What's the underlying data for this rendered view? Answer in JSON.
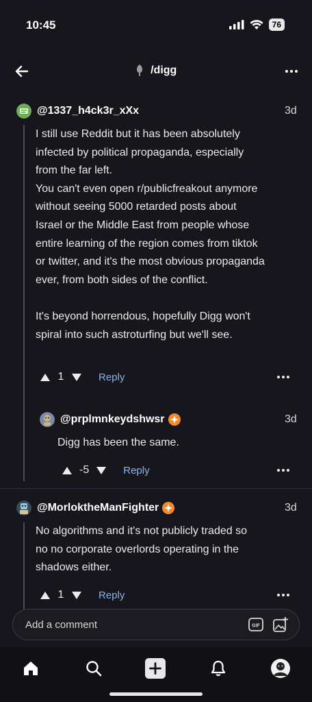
{
  "status_bar": {
    "time": "10:45",
    "battery": "76"
  },
  "header": {
    "community": "/digg"
  },
  "comments": [
    {
      "username": "@1337_h4ck3r_xXx",
      "age": "3d",
      "body": "I still use Reddit but it has been absolutely\ninfected by political propaganda, especially\nfrom the far left.\nYou can't even open r/publicfreakout anymore\nwithout seeing 5000 retarded posts about\nIsrael or the Middle East from people whose\nentire learning of the region comes from tiktok\nor twitter, and it's the most obvious propaganda\never, from both sides of the conflict.\n\nIt's beyond horrendous, hopefully Digg won't\nspiral into such astroturfing but we'll see.",
      "score": "1",
      "reply_label": "Reply",
      "has_badge": false
    },
    {
      "username": "@prplmnkeydshwsr",
      "age": "3d",
      "body": "Digg has been the same.",
      "score": "-5",
      "reply_label": "Reply",
      "has_badge": true
    },
    {
      "username": "@MorloktheManFighter",
      "age": "3d",
      "body": "No algorithms and it's not publicly traded so\nno no corporate overlords operating in the\nshadows either.",
      "score": "1",
      "reply_label": "Reply",
      "has_badge": true
    }
  ],
  "composer": {
    "placeholder": "Add a comment"
  },
  "tabbar": {
    "items": [
      "home-icon",
      "search-icon",
      "create-icon",
      "notifications-icon",
      "profile-icon"
    ]
  },
  "colors": {
    "background": "#17161c",
    "link": "#8ab4e8",
    "badge": "#f08a2c"
  }
}
